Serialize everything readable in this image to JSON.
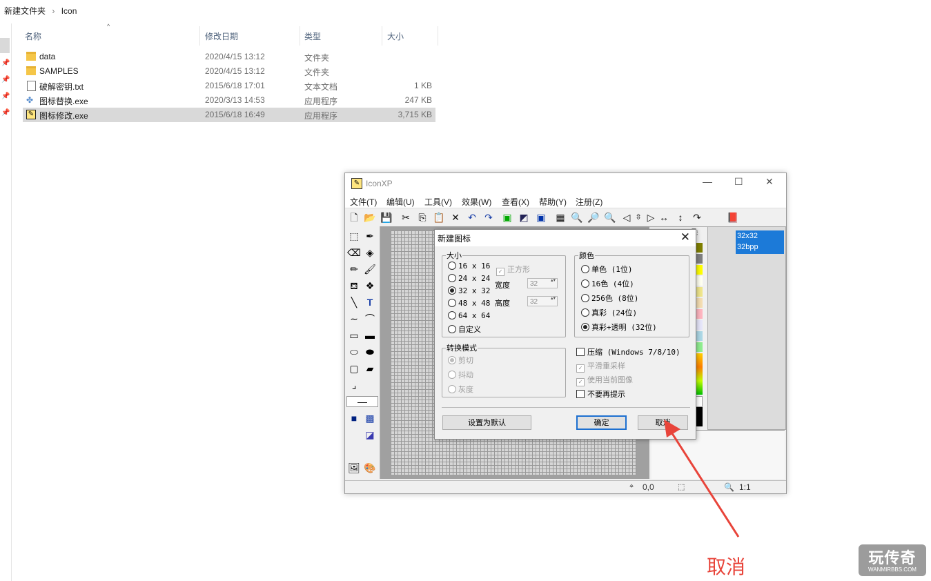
{
  "explorer": {
    "breadcrumb": [
      "新建文件夹",
      "›",
      "Icon"
    ],
    "columns": {
      "name": "名称",
      "date": "修改日期",
      "type": "类型",
      "size": "大小"
    },
    "files": [
      {
        "name": "data",
        "date": "2020/4/15 13:12",
        "type": "文件夹",
        "size": "",
        "icon": "folder-icon"
      },
      {
        "name": "SAMPLES",
        "date": "2020/4/15 13:12",
        "type": "文件夹",
        "size": "",
        "icon": "folder-icon"
      },
      {
        "name": "破解密钥.txt",
        "date": "2015/6/18 17:01",
        "type": "文本文档",
        "size": "1 KB",
        "icon": "text-file-icon"
      },
      {
        "name": "图标替换.exe",
        "date": "2020/3/13 14:53",
        "type": "应用程序",
        "size": "247 KB",
        "icon": "exe-icon"
      },
      {
        "name": "图标修改.exe",
        "date": "2015/6/18 16:49",
        "type": "应用程序",
        "size": "3,715 KB",
        "icon": "iconxp-exe-icon"
      }
    ]
  },
  "app": {
    "title": "IconXP",
    "menu": [
      "文件(T)",
      "编辑(U)",
      "工具(V)",
      "效果(W)",
      "查看(X)",
      "帮助(Y)",
      "注册(Z)"
    ],
    "format": {
      "line1": "32x32",
      "line2": "32bpp"
    },
    "status": {
      "coords": "0,0",
      "zoom": "1:1"
    },
    "palette": [
      "#808000",
      "#808080",
      "#ffff00",
      "#fffff0",
      "#f0e68c",
      "#f5deb3",
      "#ffb6c1",
      "#e6e6fa",
      "#add8e6",
      "#90ee90"
    ]
  },
  "dialog": {
    "title": "新建图标",
    "size_group": "大小",
    "sizes": [
      "16 x 16",
      "24 x 24",
      "32 x 32",
      "48 x 48",
      "64 x 64",
      "自定义"
    ],
    "square": "正方形",
    "width_label": "宽度",
    "width_value": "32",
    "height_label": "高度",
    "height_value": "32",
    "color_group": "颜色",
    "colors": [
      "单色 (1位)",
      "16色 (4位)",
      "256色 (8位)",
      "真彩 (24位)",
      "真彩+透明 (32位)"
    ],
    "convert_group": "转换模式",
    "convert_modes": [
      "剪切",
      "抖动",
      "灰度"
    ],
    "compress": "压缩 (Windows 7/8/10)",
    "smooth": "平滑重采样",
    "use_current": "使用当前图像",
    "no_prompt": "不要再提示",
    "default_button": "设置为默认",
    "ok_button": "确定",
    "cancel_button": "取消"
  },
  "annotation": {
    "label": "取消",
    "color": "#e8443a"
  },
  "watermark": {
    "line1": "玩传奇",
    "line2": "WANMIRBBS.COM"
  }
}
